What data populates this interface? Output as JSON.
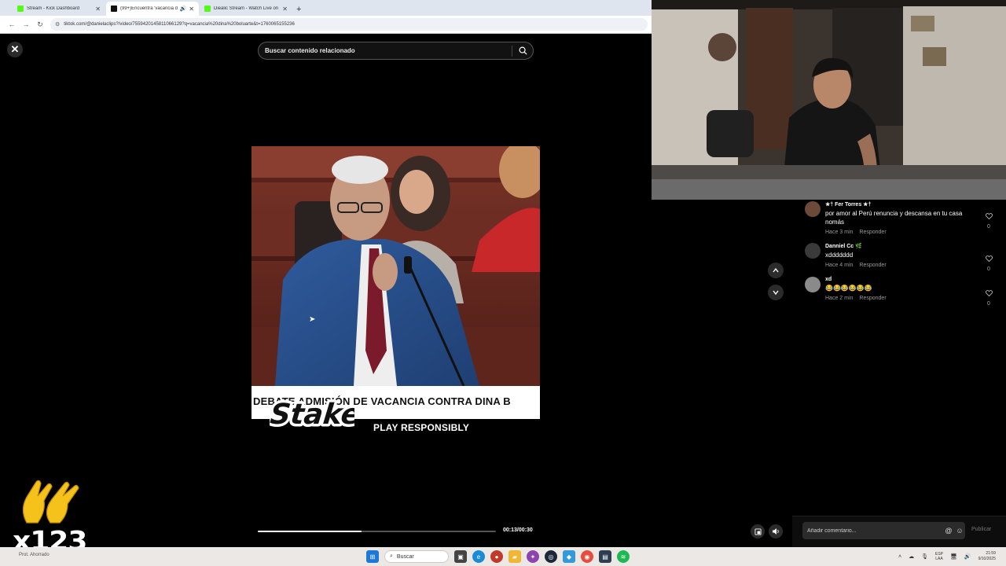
{
  "browser": {
    "tabs": [
      {
        "title": "Stream - Kick Dashboard",
        "favicon_color": "#53fc18",
        "active": false
      },
      {
        "title": "(99+)Encuentra 'vacancia d",
        "favicon_color": "#111111",
        "active": true
      },
      {
        "title": "Diealic Stream - Watch Live on",
        "favicon_color": "#53fc18",
        "active": false
      }
    ],
    "new_tab_icon": "plus-icon",
    "url": "tiktok.com/@danielaclips?/video/7559420145811066129?q=vacancia%20dina%20boluarte&t=1760065155236"
  },
  "player": {
    "search_placeholder": "Buscar contenido relacionado",
    "caption_text": "DEBATE ADMISIÓN DE VACANCIA CONTRA DINA B",
    "sponsor_logo_text": "Stake",
    "sponsor_tagline": "PLAY RESPONSIBLY",
    "progress_fraction": 0.435,
    "time_display": "00:13/00:30"
  },
  "overlay": {
    "multiplier_text": "x123",
    "emoji": "clapping-hands"
  },
  "comments": [
    {
      "username": "★† Fer Torres ★†",
      "text": "por amor al Perú renuncia y descansa en tu casa nomás",
      "time": "Hace 3 min",
      "reply": "Responder",
      "likes": "0",
      "avatar_color": "#6b4a3a"
    },
    {
      "username": "Danniel Cc 🌿",
      "text": "xddddddd",
      "time": "Hace 4 min",
      "reply": "Responder",
      "likes": "0",
      "avatar_color": "#3a3a3a"
    },
    {
      "username": "xd",
      "text": "😂😂😂😂😂😂",
      "time": "Hace 2 min",
      "reply": "Responder",
      "likes": "0",
      "avatar_color": "#8a8a8a"
    }
  ],
  "comment_box": {
    "placeholder": "Añadir comentario...",
    "publish_label": "Publicar"
  },
  "taskbar": {
    "left_text": "Prot. Ahorrado",
    "search_label": "Buscar",
    "lang_line1": "ESP",
    "lang_line2": "LAA",
    "time": "21:59",
    "date": "9/10/2025"
  }
}
